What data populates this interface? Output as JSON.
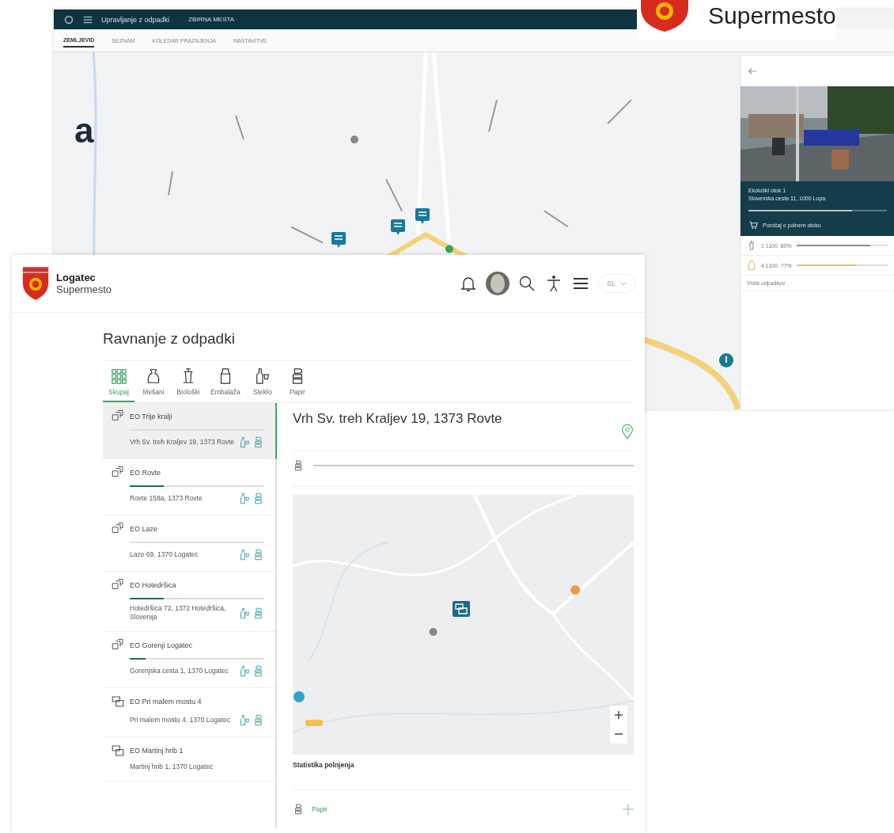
{
  "corner_logo": {
    "text": "Supermesto"
  },
  "heading_fragment": "a",
  "back_window": {
    "app_title": "Upravljanje z odpadki",
    "nav_link": "ZBIRNA MESTA",
    "tabs": [
      {
        "label": "ZEMLJEVID",
        "selected": true
      },
      {
        "label": "SEZNAM",
        "selected": false
      },
      {
        "label": "KOLEDAR PRAZNJENJA",
        "selected": false
      },
      {
        "label": "NASTAVITVE",
        "selected": false
      }
    ],
    "panel": {
      "name": "Ekološki otok 1",
      "address": "Slovenska cesta 11, 1000 Lupa",
      "level": 0.75,
      "report": "Poročaj o polnem otoku",
      "containers": [
        {
          "kind": "bin",
          "text": "1 1100  80%",
          "level": 0.8,
          "color": "#8a8a8a"
        },
        {
          "kind": "packaging",
          "text": "4 1100  77%",
          "level": 0.65,
          "color": "#f0c060"
        }
      ],
      "more": "Vrste odpadkov"
    }
  },
  "header": {
    "brand": "Logatec",
    "sub": "Supermesto",
    "language": "SL"
  },
  "page_title": "Ravnanje z odpadki",
  "categories": [
    {
      "label": "Skupaj",
      "kind": "all",
      "selected": true
    },
    {
      "label": "Mešani",
      "kind": "mixed",
      "selected": false
    },
    {
      "label": "Biološki",
      "kind": "bio",
      "selected": false
    },
    {
      "label": "Embalaža",
      "kind": "packaging",
      "selected": false
    },
    {
      "label": "Steklo",
      "kind": "glass",
      "selected": false
    },
    {
      "label": "Papir",
      "kind": "paper",
      "selected": false
    }
  ],
  "locations": [
    {
      "name": "EO Trije kralji",
      "address": "Vrh Sv. treh Kraljev 19, 1373 Rovte",
      "kind": "island",
      "selected": true,
      "containers": [
        {
          "kind": "glass"
        },
        {
          "kind": "paper"
        }
      ]
    },
    {
      "name": "EO Rovte",
      "address": "Rovte 158a, 1373 Rovte",
      "kind": "island",
      "level": 0.25,
      "selected": false,
      "containers": [
        {
          "kind": "glass"
        },
        {
          "kind": "paper"
        }
      ]
    },
    {
      "name": "EO Laze",
      "address": "Laze 69, 1370 Logatec",
      "kind": "island",
      "selected": false,
      "containers": [
        {
          "kind": "glass"
        },
        {
          "kind": "paper"
        }
      ]
    },
    {
      "name": "EO Hotedršica",
      "address": "Hotedršica 72, 1372 Hotedršica, Slovenija",
      "kind": "island",
      "level": 0.25,
      "selected": false,
      "containers": [
        {
          "kind": "glass"
        },
        {
          "kind": "paper"
        }
      ]
    },
    {
      "name": "EO Gorenji Logatec",
      "address": "Gorenjska cesta 1, 1370 Logatec",
      "kind": "island",
      "level": 0.12,
      "selected": false,
      "containers": [
        {
          "kind": "glass"
        },
        {
          "kind": "paper"
        }
      ]
    },
    {
      "name": "EO Pri malem mostu 4",
      "address": "Pri malem mostu 4, 1370 Logatec",
      "kind": "point",
      "selected": false,
      "containers": [
        {
          "kind": "glass"
        },
        {
          "kind": "paper"
        }
      ]
    },
    {
      "name": "EO Martinj hrib 1",
      "address": "Martinj hrib 1, 1370 Logatec",
      "kind": "point",
      "selected": false
    }
  ],
  "detail": {
    "title": "Vrh Sv. treh Kraljev 19, 1373 Rovte",
    "fill": [
      {
        "kind": "paper"
      }
    ],
    "stats_title": "Statistika polnjenja",
    "stats_rows": [
      {
        "kind": "paper",
        "label": "Papir"
      }
    ]
  }
}
